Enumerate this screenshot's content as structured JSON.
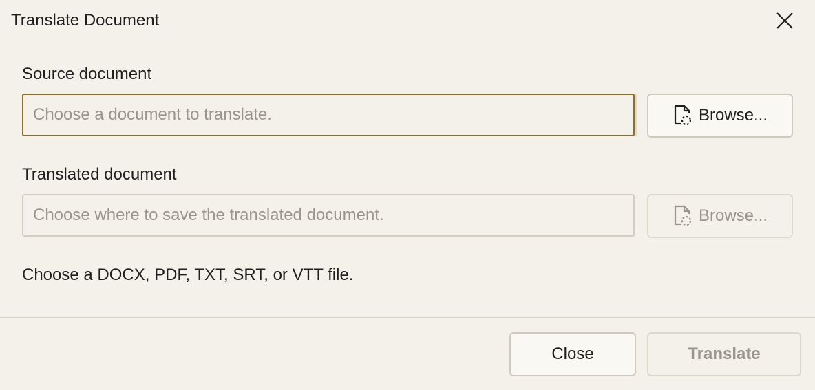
{
  "dialog": {
    "title": "Translate Document"
  },
  "source": {
    "label": "Source document",
    "placeholder": "Choose a document to translate.",
    "browse_label": "Browse..."
  },
  "translated": {
    "label": "Translated document",
    "placeholder": "Choose where to save the translated document.",
    "browse_label": "Browse..."
  },
  "hint": "Choose a DOCX, PDF, TXT, SRT, or VTT file.",
  "footer": {
    "close_label": "Close",
    "translate_label": "Translate"
  },
  "icons": {
    "close": "close-icon",
    "file": "file-icon"
  },
  "colors": {
    "background": "#f4f1ea",
    "focus_border": "#8e6f2a",
    "disabled_text": "#9a958c"
  }
}
